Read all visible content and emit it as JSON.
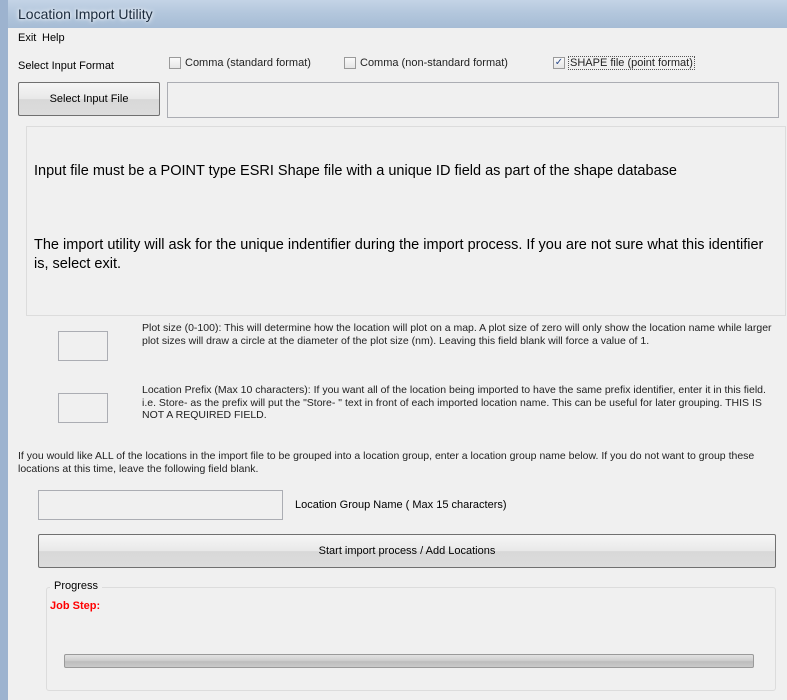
{
  "window": {
    "title": "Location Import Utility"
  },
  "menu": {
    "exit": "Exit",
    "help": "Help"
  },
  "format": {
    "label": "Select Input Format",
    "options": [
      {
        "label": "Comma (standard format)",
        "checked": false
      },
      {
        "label": "Comma (non-standard format)",
        "checked": false
      },
      {
        "label": "SHAPE file (point format)",
        "checked": true
      }
    ]
  },
  "input_file": {
    "button_label": "Select Input File",
    "path": ""
  },
  "info": {
    "line1": "Input file must be a POINT type ESRI Shape file with a unique ID field as part of the shape database",
    "line2": "The import utility will ask for the unique indentifier during the import process.  If you are not sure what this identifier is, select exit."
  },
  "plot_size": {
    "value": "",
    "description": "Plot size (0-100):  This will determine how the location will plot on a map.  A plot size of zero will only show the location name while larger plot sizes will draw a circle at the diameter of the plot size (nm).  Leaving this field blank will force a value of 1."
  },
  "prefix": {
    "value": "",
    "description": "Location Prefix (Max 10 characters):  If you want all of the location being imported to have the same prefix identifier, enter it in this field.  i.e. Store- as the prefix will put the \"Store- \" text in front of each imported location name.  This can be useful for later grouping.  THIS IS NOT A REQUIRED FIELD."
  },
  "group": {
    "instructions": "If you would like ALL of the locations in the import file to be grouped into a location group, enter a location group name below.  If you do not want to group these locations at this time, leave the following field blank.",
    "value": "",
    "label": "Location Group Name ( Max 15 characters)"
  },
  "start_button": {
    "label": "Start import process / Add Locations"
  },
  "progress": {
    "title": "Progress",
    "job_step_label": "Job Step:",
    "value": 0
  },
  "colors": {
    "job_step": "#ff0000",
    "title_bar": "#b2c6dc"
  }
}
